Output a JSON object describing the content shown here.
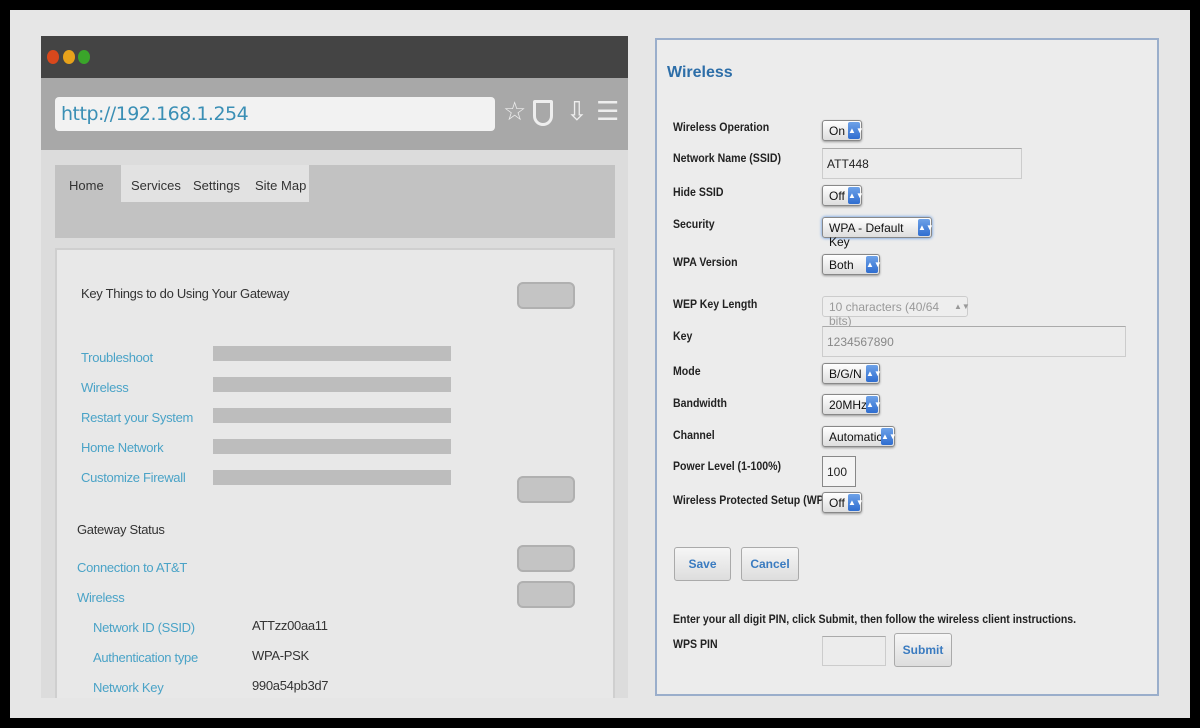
{
  "browser": {
    "url": "http://192.168.1.254",
    "toolbar_icons": [
      "star-icon",
      "shield-icon",
      "download-icon",
      "menu-icon"
    ],
    "tabs": [
      "Home",
      "Services",
      "Settings",
      "Site Map"
    ],
    "key_things_title": "Key Things to do Using Your Gateway",
    "key_links": [
      "Troubleshoot",
      "Wireless",
      "Restart your System",
      "Home Network",
      "Customize Firewall"
    ],
    "gateway_status_title": "Gateway Status",
    "status_links": [
      "Connection to AT&T",
      "Wireless"
    ],
    "status_rows": [
      {
        "label": "Network ID (SSID)",
        "value": "ATTzz00aa11"
      },
      {
        "label": "Authentication type",
        "value": "WPA-PSK"
      },
      {
        "label": "Network Key",
        "value": "990a54pb3d7"
      }
    ]
  },
  "wireless": {
    "title": "Wireless",
    "wireless_operation": {
      "label": "Wireless Operation",
      "value": "On"
    },
    "ssid": {
      "label": "Network Name (SSID)",
      "value": "ATT448"
    },
    "hide_ssid": {
      "label": "Hide SSID",
      "value": "Off"
    },
    "security": {
      "label": "Security",
      "value": "WPA - Default Key"
    },
    "wpa_version": {
      "label": "WPA Version",
      "value": "Both"
    },
    "wep_key_length": {
      "label": "WEP Key Length",
      "value": "10 characters (40/64 bits)"
    },
    "key": {
      "label": "Key",
      "value": "1234567890"
    },
    "mode": {
      "label": "Mode",
      "value": "B/G/N"
    },
    "bandwidth": {
      "label": "Bandwidth",
      "value": "20MHz"
    },
    "channel": {
      "label": "Channel",
      "value": "Automatic"
    },
    "power": {
      "label": "Power Level (1-100%)",
      "value": "100"
    },
    "wps": {
      "label": "Wireless Protected Setup (WPS)",
      "value": "Off"
    },
    "save": "Save",
    "cancel": "Cancel",
    "wps_instructions": "Enter your all digit PIN, click Submit, then follow the wireless client instructions.",
    "wps_pin_label": "WPS PIN",
    "wps_pin_value": "",
    "submit": "Submit"
  }
}
